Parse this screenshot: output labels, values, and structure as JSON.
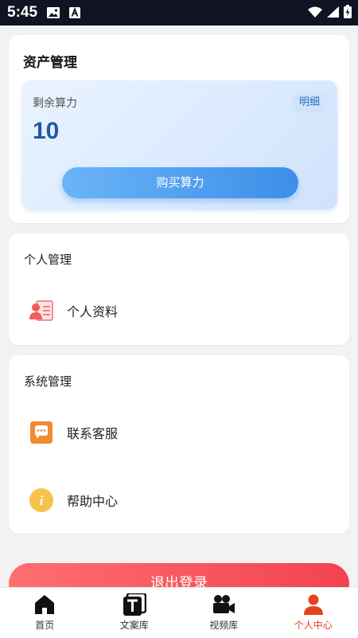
{
  "status_bar": {
    "time": "5:45"
  },
  "asset": {
    "title": "资产管理",
    "remaining_label": "剩余算力",
    "detail_label": "明细",
    "remaining_value": "10",
    "buy_label": "购买算力"
  },
  "personal": {
    "title": "个人管理",
    "items": [
      {
        "label": "个人资料",
        "icon": "profile-card-icon"
      }
    ]
  },
  "system": {
    "title": "系统管理",
    "items": [
      {
        "label": "联系客服",
        "icon": "chat-icon"
      },
      {
        "label": "帮助中心",
        "icon": "info-icon"
      }
    ]
  },
  "logout_label": "退出登录",
  "tabs": [
    {
      "label": "首页",
      "icon": "home-icon"
    },
    {
      "label": "文案库",
      "icon": "text-library-icon"
    },
    {
      "label": "视频库",
      "icon": "video-camera-icon"
    },
    {
      "label": "个人中心",
      "icon": "person-icon",
      "active": true
    }
  ],
  "colors": {
    "accent_blue": "#3d8ee9",
    "value_blue": "#1e5aa8",
    "logout_red": "#f2434e",
    "active_tab": "#e3421e"
  }
}
